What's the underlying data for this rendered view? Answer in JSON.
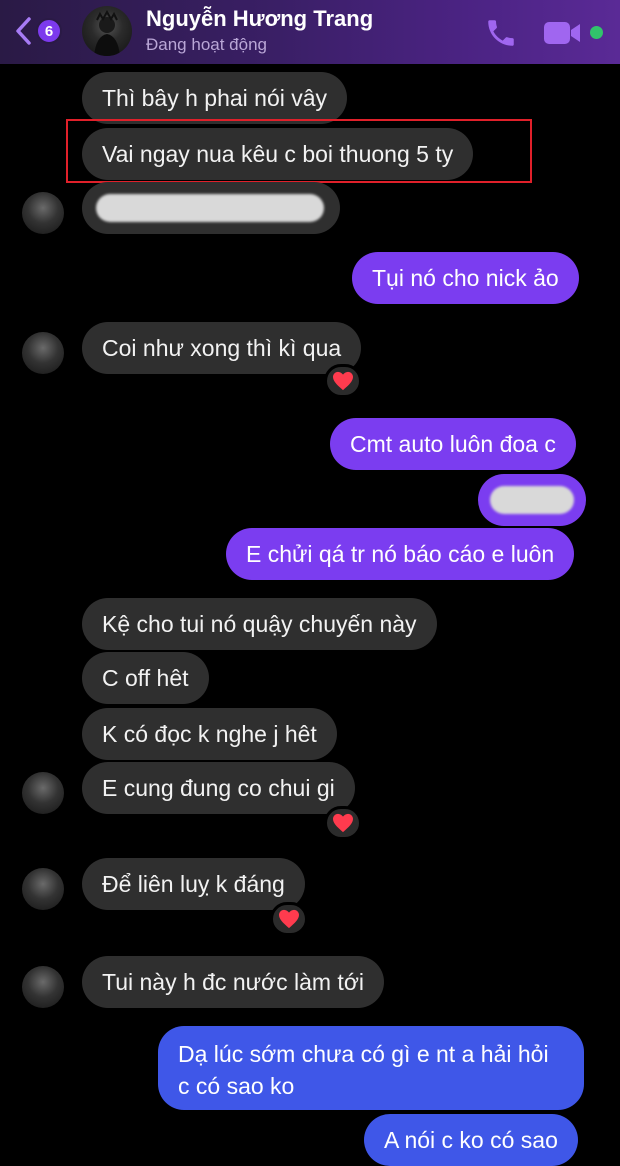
{
  "header": {
    "unread_count": "6",
    "contact_name": "Nguyễn Hương Trang",
    "status": "Đang hoạt động",
    "accent_color": "#7c3aed",
    "online_color": "#31c46b"
  },
  "messages": [
    {
      "dir": "received",
      "text": "Thì bây h phai nói vây"
    },
    {
      "dir": "received",
      "text": "Vai ngay nua kêu c boi thuong 5 ty",
      "highlighted": true
    },
    {
      "dir": "received",
      "text": "",
      "blurred": true
    },
    {
      "dir": "sent",
      "text": "Tụi nó cho nick ảo"
    },
    {
      "dir": "received",
      "text": "Coi như xong thì kì qua",
      "reaction": "heart"
    },
    {
      "dir": "sent",
      "text": "Cmt auto luôn đoa c"
    },
    {
      "dir": "sent",
      "text": "",
      "blurred": true
    },
    {
      "dir": "sent",
      "text": "E chửi qá tr nó báo cáo e luôn"
    },
    {
      "dir": "received",
      "text": "Kệ cho tui nó quậy chuyến này"
    },
    {
      "dir": "received",
      "text": "C off hêt"
    },
    {
      "dir": "received",
      "text": "K có đọc k nghe j hêt"
    },
    {
      "dir": "received",
      "text": "E cung đung co chui gi",
      "reaction": "heart"
    },
    {
      "dir": "received",
      "text": "Để liên luỵ k đáng",
      "reaction": "heart"
    },
    {
      "dir": "received",
      "text": "Tui này h đc nước làm tới"
    },
    {
      "dir": "sent",
      "text": "Dạ lúc sớm chưa có gì e nt a hải hỏi c có sao ko",
      "lines": [
        "Dạ lúc sớm chưa có gì e nt a hải hỏi",
        "c có sao ko"
      ]
    },
    {
      "dir": "sent",
      "text": "A nói c ko có sao"
    }
  ],
  "icons": {
    "back": "chevron-left-icon",
    "call": "phone-icon",
    "video": "video-camera-icon",
    "reaction": "heart-icon"
  }
}
